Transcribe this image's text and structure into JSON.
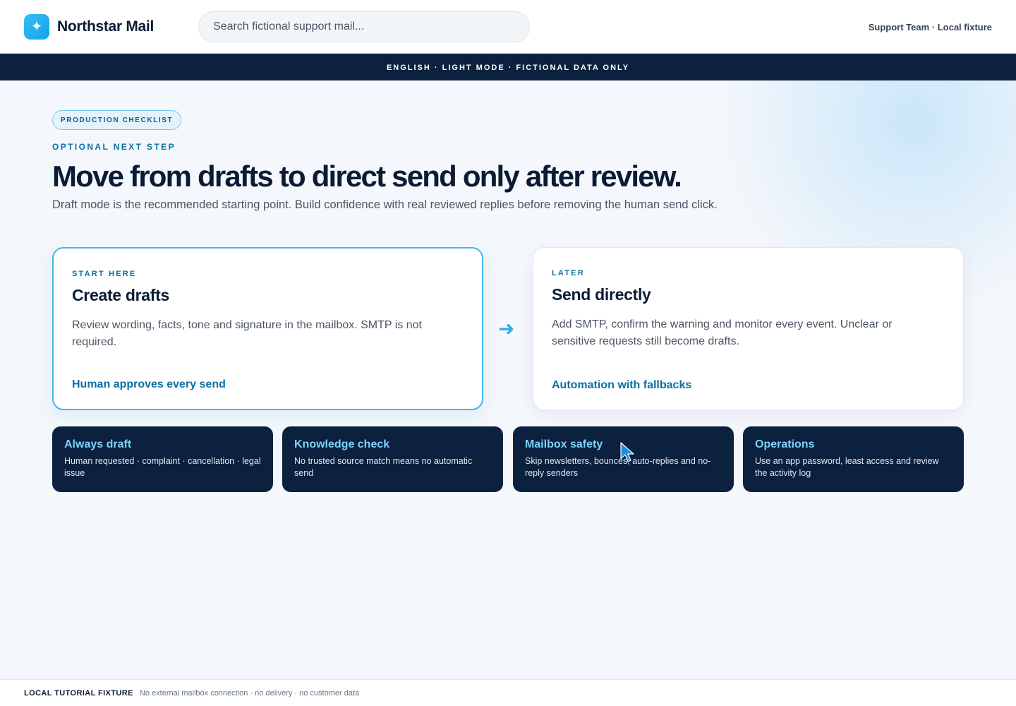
{
  "header": {
    "logo_glyph": "✦",
    "app_name": "Northstar Mail",
    "search_placeholder": "Search fictional support mail...",
    "account": "Support Team · Local fixture"
  },
  "banner": {
    "text": "ENGLISH · LIGHT MODE · FICTIONAL DATA ONLY"
  },
  "hero": {
    "badge": "PRODUCTION CHECKLIST",
    "eyebrow": "OPTIONAL NEXT STEP",
    "title": "Move from drafts to direct send only after review.",
    "subtitle": "Draft mode is the recommended starting point. Build confidence with real reviewed replies before removing the human send click."
  },
  "cards": [
    {
      "eyebrow": "START HERE",
      "title": "Create drafts",
      "description": "Review wording, facts, tone and signature in the mailbox. SMTP is not required.",
      "footer": "Human approves every send"
    },
    {
      "eyebrow": "LATER",
      "title": "Send directly",
      "description": "Add SMTP, confirm the warning and monitor every event. Unclear or sensitive requests still become drafts.",
      "footer": "Automation with fallbacks"
    }
  ],
  "arrow_glyph": "➜",
  "tiles": [
    {
      "title": "Always draft",
      "description": "Human requested · complaint · cancellation · legal issue"
    },
    {
      "title": "Knowledge check",
      "description": "No trusted source match means no automatic send"
    },
    {
      "title": "Mailbox safety",
      "description": "Skip newsletters, bounces, auto-replies and no-reply senders"
    },
    {
      "title": "Operations",
      "description": "Use an app password, least access and review the activity log"
    }
  ],
  "footer": {
    "label": "LOCAL TUTORIAL FIXTURE",
    "note": "No external mailbox connection · no delivery · no customer data"
  },
  "colors": {
    "accent": "#0b6fa3",
    "navy": "#0b213d",
    "tile_title": "#7dd3fc",
    "card_border_active": "#45b6e6"
  }
}
